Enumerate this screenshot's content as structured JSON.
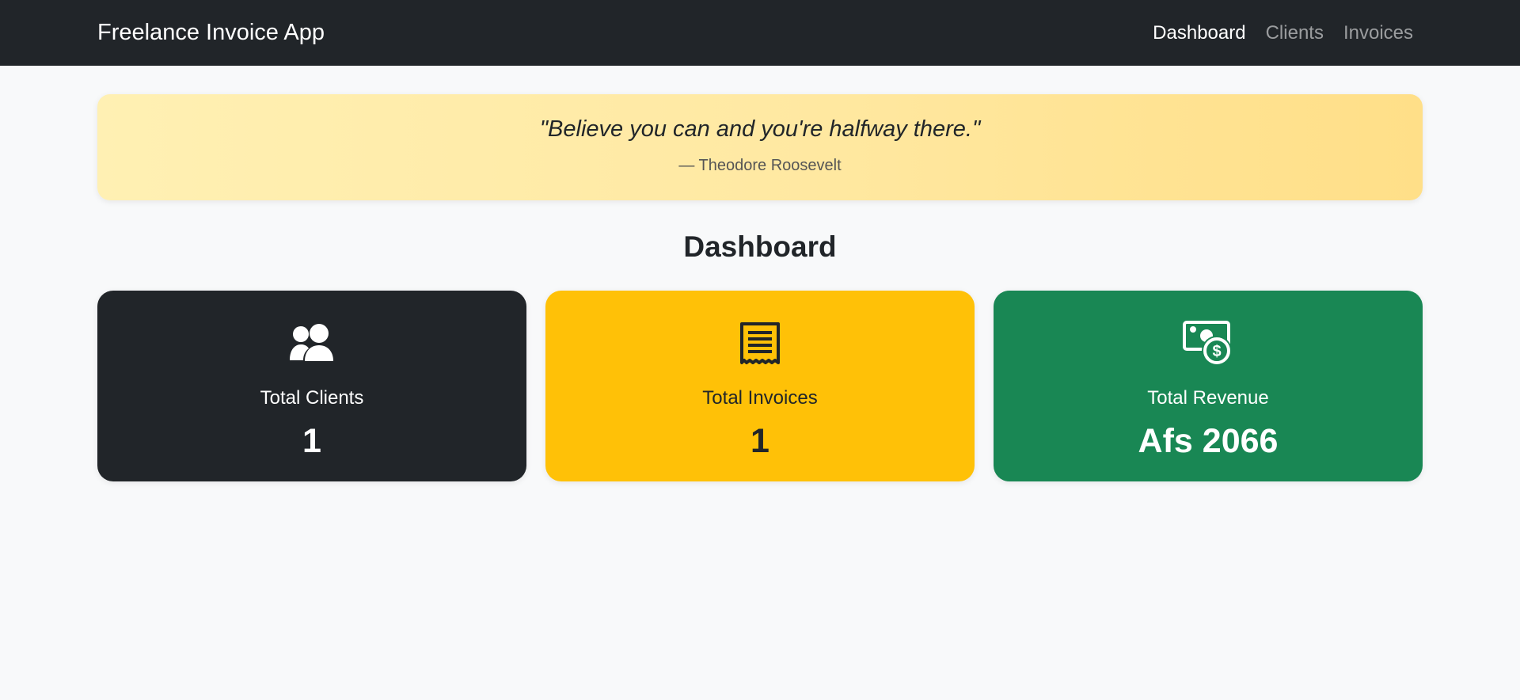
{
  "navbar": {
    "brand": "Freelance Invoice App",
    "links": [
      {
        "label": "Dashboard",
        "active": true
      },
      {
        "label": "Clients",
        "active": false
      },
      {
        "label": "Invoices",
        "active": false
      }
    ]
  },
  "quote": {
    "text": "\"Believe you can and you're halfway there.\"",
    "author": "— Theodore Roosevelt"
  },
  "page": {
    "title": "Dashboard"
  },
  "cards": [
    {
      "icon": "users-icon",
      "label": "Total Clients",
      "value": "1",
      "color": "#212529"
    },
    {
      "icon": "receipt-icon",
      "label": "Total Invoices",
      "value": "1",
      "color": "#ffc107"
    },
    {
      "icon": "money-icon",
      "label": "Total Revenue",
      "value": "Afs 2066",
      "color": "#198754"
    }
  ]
}
